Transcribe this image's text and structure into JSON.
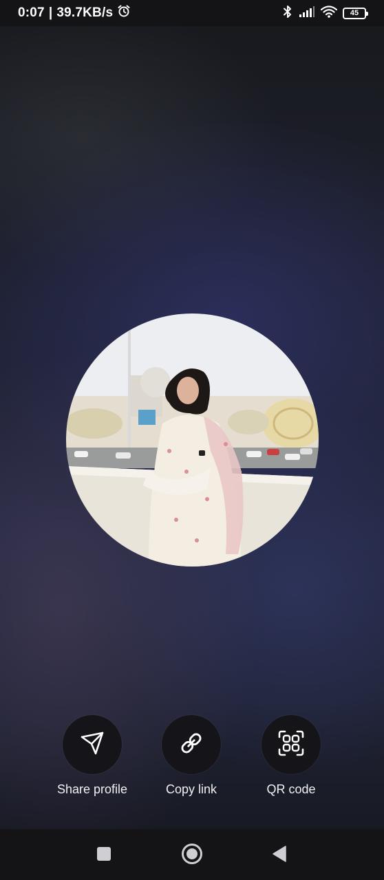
{
  "status_bar": {
    "time": "0:07",
    "separator": "|",
    "network_speed": "39.7KB/s",
    "battery_level": "45",
    "icons": [
      "alarm-icon",
      "bluetooth-icon",
      "signal-icon",
      "wifi-icon",
      "battery-icon"
    ]
  },
  "profile": {
    "avatar": "profile-photo-avatar"
  },
  "actions": [
    {
      "label": "Share profile",
      "icon": "send-icon"
    },
    {
      "label": "Copy link",
      "icon": "link-icon"
    },
    {
      "label": "QR code",
      "icon": "qr-code-icon"
    }
  ],
  "nav_bar": {
    "buttons": [
      "recents-square",
      "home-circle",
      "back-triangle"
    ]
  },
  "colors": {
    "background_top": "#18191c",
    "background_mid": "#232640",
    "button_fill": "#151519",
    "text": "#ffffff"
  }
}
